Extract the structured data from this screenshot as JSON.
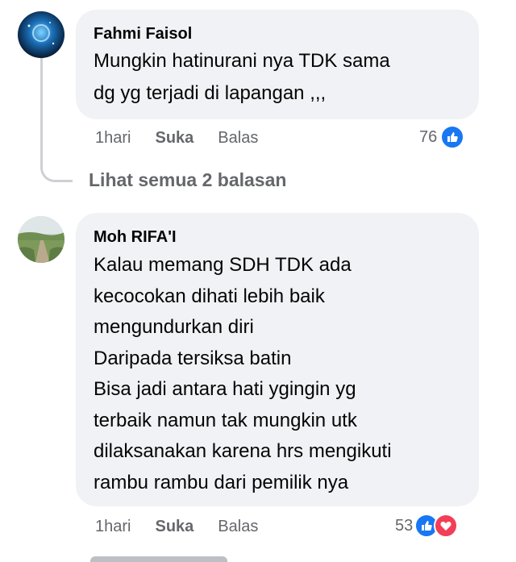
{
  "comments": [
    {
      "author": "Fahmi Faisol",
      "text": "Mungkin hatinurani nya TDK sama\ndg yg terjadi di lapangan ,,,",
      "time": "1hari",
      "like_label": "Suka",
      "reply_label": "Balas",
      "reaction_count": "76",
      "reactions": [
        "like-icon"
      ]
    },
    {
      "author": "Moh RIFA'I",
      "text": "Kalau memang SDH TDK ada\nkecocokan dihati lebih baik\nmengundurkan diri\nDaripada tersiksa batin\nBisa jadi antara hati ygingin yg\nterbaik namun tak mungkin utk\ndilaksanakan karena hrs mengikuti\nrambu rambu dari pemilik nya",
      "time": "1hari",
      "like_label": "Suka",
      "reply_label": "Balas",
      "reaction_count": "53",
      "reactions": [
        "like-icon",
        "love-icon"
      ]
    }
  ],
  "view_replies_label": "Lihat semua 2 balasan",
  "colors": {
    "bubble": "#f0f2f5",
    "meta": "#65676b",
    "like_blue": "#1877f2",
    "love_red": "#f33e58",
    "thread_line": "#ced0d4"
  }
}
